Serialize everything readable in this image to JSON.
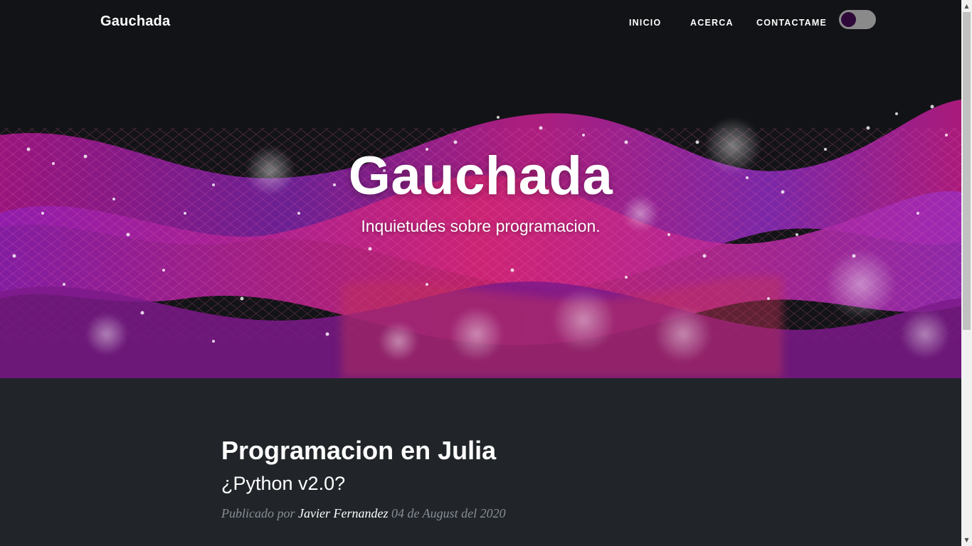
{
  "navbar": {
    "brand": "Gauchada",
    "links": [
      {
        "label": "INICIO"
      },
      {
        "label": "ACERCA"
      },
      {
        "label": "CONTACTAME"
      }
    ],
    "theme_toggle": {
      "state": "dark"
    }
  },
  "hero": {
    "title": "Gauchada",
    "subtitle": "Inquietudes sobre programacion."
  },
  "post": {
    "title": "Programacion en Julia",
    "subtitle": "¿Python v2.0?",
    "meta_prefix": "Publicado por",
    "author": "Javier Fernandez",
    "date": "04 de August del 2020"
  },
  "colors": {
    "hero_bg": "#121316",
    "page_bg": "#212529",
    "wave_magenta": "#c0209a",
    "wave_purple": "#6a1fb0",
    "toggle_track": "#8a8a8a",
    "toggle_knob": "#2e0838",
    "meta_gray": "#868e96"
  },
  "icons": {
    "scroll_up": "triangle-up-icon",
    "scroll_down": "triangle-down-icon"
  }
}
